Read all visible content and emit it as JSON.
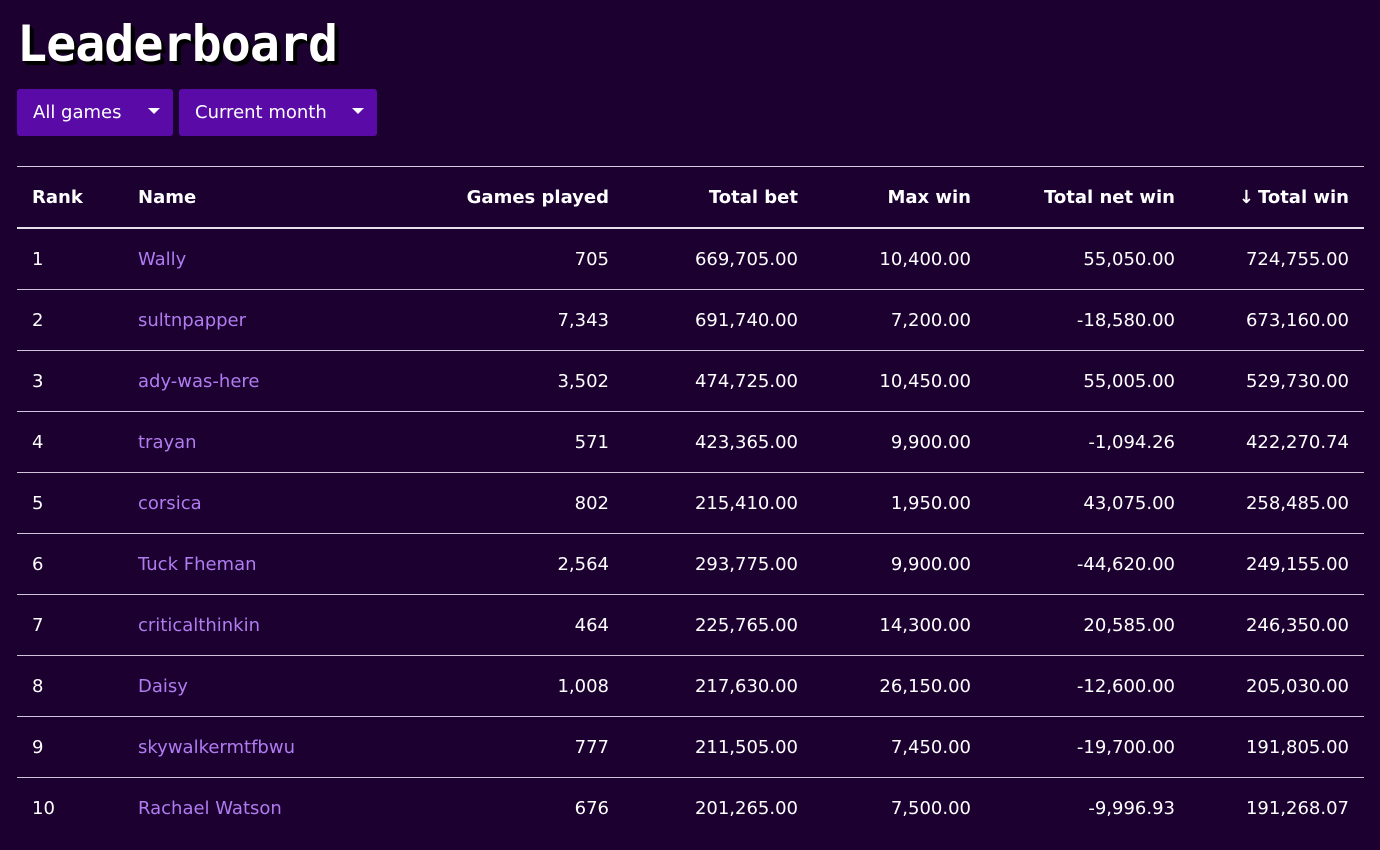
{
  "page": {
    "title": "Leaderboard"
  },
  "filters": {
    "game": {
      "selected": "All games"
    },
    "period": {
      "selected": "Current month"
    }
  },
  "table": {
    "headers": {
      "rank": "Rank",
      "name": "Name",
      "games_played": "Games played",
      "total_bet": "Total bet",
      "max_win": "Max win",
      "total_net_win": "Total net win",
      "total_win": "Total win"
    },
    "sort_icon": "arrow-down-icon",
    "sorted_by": "total_win",
    "rows": [
      {
        "rank": "1",
        "name": "Wally",
        "games_played": "705",
        "total_bet": "669,705.00",
        "max_win": "10,400.00",
        "total_net_win": "55,050.00",
        "total_win": "724,755.00"
      },
      {
        "rank": "2",
        "name": "sultnpapper",
        "games_played": "7,343",
        "total_bet": "691,740.00",
        "max_win": "7,200.00",
        "total_net_win": "-18,580.00",
        "total_win": "673,160.00"
      },
      {
        "rank": "3",
        "name": "ady-was-here",
        "games_played": "3,502",
        "total_bet": "474,725.00",
        "max_win": "10,450.00",
        "total_net_win": "55,005.00",
        "total_win": "529,730.00"
      },
      {
        "rank": "4",
        "name": "trayan",
        "games_played": "571",
        "total_bet": "423,365.00",
        "max_win": "9,900.00",
        "total_net_win": "-1,094.26",
        "total_win": "422,270.74"
      },
      {
        "rank": "5",
        "name": "corsica",
        "games_played": "802",
        "total_bet": "215,410.00",
        "max_win": "1,950.00",
        "total_net_win": "43,075.00",
        "total_win": "258,485.00"
      },
      {
        "rank": "6",
        "name": "Tuck Fheman",
        "games_played": "2,564",
        "total_bet": "293,775.00",
        "max_win": "9,900.00",
        "total_net_win": "-44,620.00",
        "total_win": "249,155.00"
      },
      {
        "rank": "7",
        "name": "criticalthinkin",
        "games_played": "464",
        "total_bet": "225,765.00",
        "max_win": "14,300.00",
        "total_net_win": "20,585.00",
        "total_win": "246,350.00"
      },
      {
        "rank": "8",
        "name": "Daisy",
        "games_played": "1,008",
        "total_bet": "217,630.00",
        "max_win": "26,150.00",
        "total_net_win": "-12,600.00",
        "total_win": "205,030.00"
      },
      {
        "rank": "9",
        "name": "skywalkermtfbwu",
        "games_played": "777",
        "total_bet": "211,505.00",
        "max_win": "7,450.00",
        "total_net_win": "-19,700.00",
        "total_win": "191,805.00"
      },
      {
        "rank": "10",
        "name": "Rachael Watson",
        "games_played": "676",
        "total_bet": "201,265.00",
        "max_win": "7,500.00",
        "total_net_win": "-9,996.93",
        "total_win": "191,268.07"
      }
    ]
  },
  "colors": {
    "background": "#1b0030",
    "select_background": "#5a0aa6",
    "link": "#b07cf0",
    "text": "#ffffff"
  }
}
